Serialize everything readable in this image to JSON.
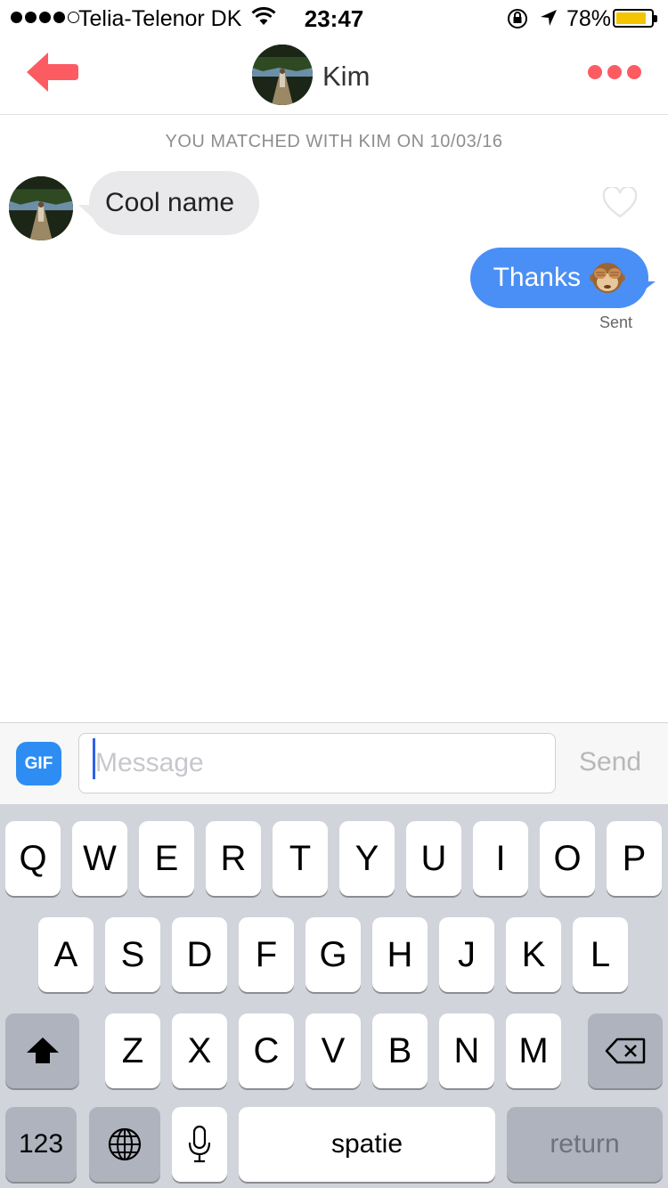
{
  "status_bar": {
    "carrier": "Telia-Telenor DK",
    "time": "23:47",
    "battery_percent": "78%",
    "battery_level": 0.78,
    "signal_bars": 4,
    "signal_max": 5
  },
  "header": {
    "contact_name": "Kim",
    "accent_color": "#fd5b62"
  },
  "chat": {
    "match_notice": "YOU MATCHED WITH KIM ON 10/03/16",
    "messages": [
      {
        "direction": "incoming",
        "text": "Cool name",
        "liked": false
      },
      {
        "direction": "outgoing",
        "text": "Thanks",
        "emoji": "see-no-evil-monkey",
        "status": "Sent"
      }
    ],
    "outgoing_color": "#4a8ff5",
    "incoming_color": "#e9e9eb"
  },
  "composer": {
    "gif_label": "GIF",
    "placeholder": "Message",
    "value": "",
    "send_label": "Send"
  },
  "keyboard": {
    "row1": [
      "Q",
      "W",
      "E",
      "R",
      "T",
      "Y",
      "U",
      "I",
      "O",
      "P"
    ],
    "row2": [
      "A",
      "S",
      "D",
      "F",
      "G",
      "H",
      "J",
      "K",
      "L"
    ],
    "row3": [
      "Z",
      "X",
      "C",
      "V",
      "B",
      "N",
      "M"
    ],
    "numbers_label": "123",
    "space_label": "spatie",
    "return_label": "return"
  }
}
